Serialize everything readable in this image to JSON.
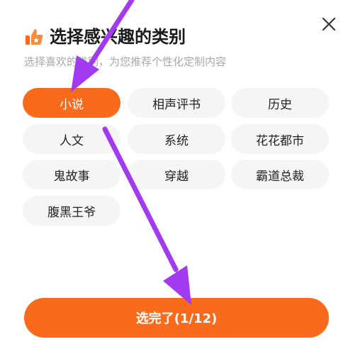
{
  "dialog": {
    "title": "选择感兴趣的类别",
    "subtitle": "选择喜欢的类别，为您推荐个性化定制内容",
    "close_icon": "close-icon",
    "title_icon": "thumbs-up-star-icon"
  },
  "categories": [
    {
      "label": "小说",
      "selected": true
    },
    {
      "label": "相声评书",
      "selected": false
    },
    {
      "label": "历史",
      "selected": false
    },
    {
      "label": "人文",
      "selected": false
    },
    {
      "label": "系统",
      "selected": false
    },
    {
      "label": "花花都市",
      "selected": false
    },
    {
      "label": "鬼故事",
      "selected": false
    },
    {
      "label": "穿越",
      "selected": false
    },
    {
      "label": "霸道总裁",
      "selected": false
    },
    {
      "label": "腹黑王爷",
      "selected": false
    }
  ],
  "confirm_button": {
    "label": "选完了(1/12)"
  },
  "colors": {
    "accent": "#fa6a1c",
    "annotation_arrow": "#a23bf0"
  }
}
